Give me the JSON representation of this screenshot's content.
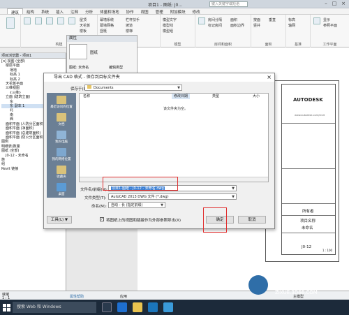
{
  "titlebar": {
    "title": "项目1 - 图纸: J0...",
    "search_placeholder": "键入关键字或短语"
  },
  "tabs": [
    "建筑",
    "结构",
    "系统",
    "插入",
    "注释",
    "分析",
    "体量和场地",
    "协作",
    "视图",
    "管理",
    "附加模块",
    "修改"
  ],
  "ribbon": {
    "groups": [
      "构建",
      "楼梯坡道",
      "模型",
      "房间和面积",
      "面积",
      "基准",
      "工作平面"
    ],
    "items": [
      "墙",
      "门",
      "窗",
      "构件",
      "柱",
      "屋顶",
      "天花板",
      "楼板",
      "幕墙系统",
      "幕墙网格",
      "竖梃",
      "栏杆扶手",
      "坡道",
      "楼梯",
      "模型文字",
      "模型线",
      "模型组",
      "房间",
      "房间分隔",
      "标记房间",
      "面积",
      "面积边界",
      "标记面积",
      "按面",
      "竖井",
      "墙",
      "垂直",
      "老虎窗",
      "标高",
      "轴网",
      "设置",
      "显示",
      "参照平面",
      "查看器"
    ]
  },
  "properties": {
    "title": "属性",
    "type": "图纸",
    "category": "图纸: 未命名",
    "edit_type": "编辑类型"
  },
  "project_browser": {
    "title": "项目浏览器 - 项目1",
    "items": [
      {
        "label": "[o] 视图 (全部)",
        "indent": 0
      },
      {
        "label": "楼层平面",
        "indent": 1
      },
      {
        "label": "场地",
        "indent": 2
      },
      {
        "label": "标高 1",
        "indent": 2
      },
      {
        "label": "标高 2",
        "indent": 2
      },
      {
        "label": "天花板平面",
        "indent": 1
      },
      {
        "label": "三维视图",
        "indent": 1
      },
      {
        "label": "{三维}",
        "indent": 2
      },
      {
        "label": "立面 (建筑立面)",
        "indent": 1
      },
      {
        "label": "东",
        "indent": 2
      },
      {
        "label": "东 副本 1",
        "indent": 2,
        "selected": true
      },
      {
        "label": "北",
        "indent": 2
      },
      {
        "label": "南",
        "indent": 2
      },
      {
        "label": "西",
        "indent": 2
      },
      {
        "label": "面积平面 (人防分区面积)",
        "indent": 1
      },
      {
        "label": "面积平面 (净面积)",
        "indent": 1
      },
      {
        "label": "面积平面 (总建筑面积)",
        "indent": 1
      },
      {
        "label": "面积平面 (防火分区面积)",
        "indent": 1
      },
      {
        "label": "图例",
        "indent": 0
      },
      {
        "label": "明细表/数量",
        "indent": 0
      },
      {
        "label": "图纸 (全部)",
        "indent": 0
      },
      {
        "label": "J0-12 - 未命名",
        "indent": 1
      },
      {
        "label": "族",
        "indent": 0
      },
      {
        "label": "组",
        "indent": 0
      },
      {
        "label": "Revit 链接",
        "indent": 0
      }
    ]
  },
  "dialog": {
    "title": "导出 CAD 格式 - 保存到目标文件夹",
    "save_in_label": "保存于(I):",
    "save_in_value": "Documents",
    "places": [
      "最近访问的位置",
      "文档",
      "我的电脑",
      "我的网络位置",
      "收藏夹",
      "桌面"
    ],
    "columns": {
      "name": "名称",
      "modified": "修改日期",
      "type": "类型",
      "size": "大小"
    },
    "empty_text": "该文件夹为空。",
    "filename_label": "文件名/前缀(N):",
    "filename_value": "项目1-图纸 - J0-12 - 未命名.dwg",
    "filetype_label": "文件类型(T):",
    "filetype_value": "AutoCAD 2013 DWG 文件 (*.dwg)",
    "naming_label": "命名(M):",
    "naming_value": "自动 - 长 (指定前缀)",
    "checkbox_label": "将图纸上的视图和链接作为外部参照导出(X)",
    "checkbox_checked": true,
    "tools_label": "工具(L)",
    "ok_label": "确定",
    "cancel_label": "取消"
  },
  "sheet": {
    "company": "AUTODESK",
    "url": "www.autodesk.com/revit",
    "owner": "所有者",
    "project_name": "项目名称",
    "sheet_name": "未命名",
    "number": "J0-12",
    "scale": "1 : 100"
  },
  "status": {
    "left": "就绪",
    "scale": "1 : 1",
    "view_label": "主模型",
    "extra": "属性帮助",
    "apply": "应用"
  },
  "taskbar": {
    "search": "搜索 Web 和 Windows"
  },
  "watermark": {
    "brand": "溜溜自学",
    "url": "ZIXUE.3D66.COM"
  },
  "colors": {
    "accent": "#2f6ea8",
    "highlight": "#e03030",
    "taskbar": "#1c2a3a"
  }
}
